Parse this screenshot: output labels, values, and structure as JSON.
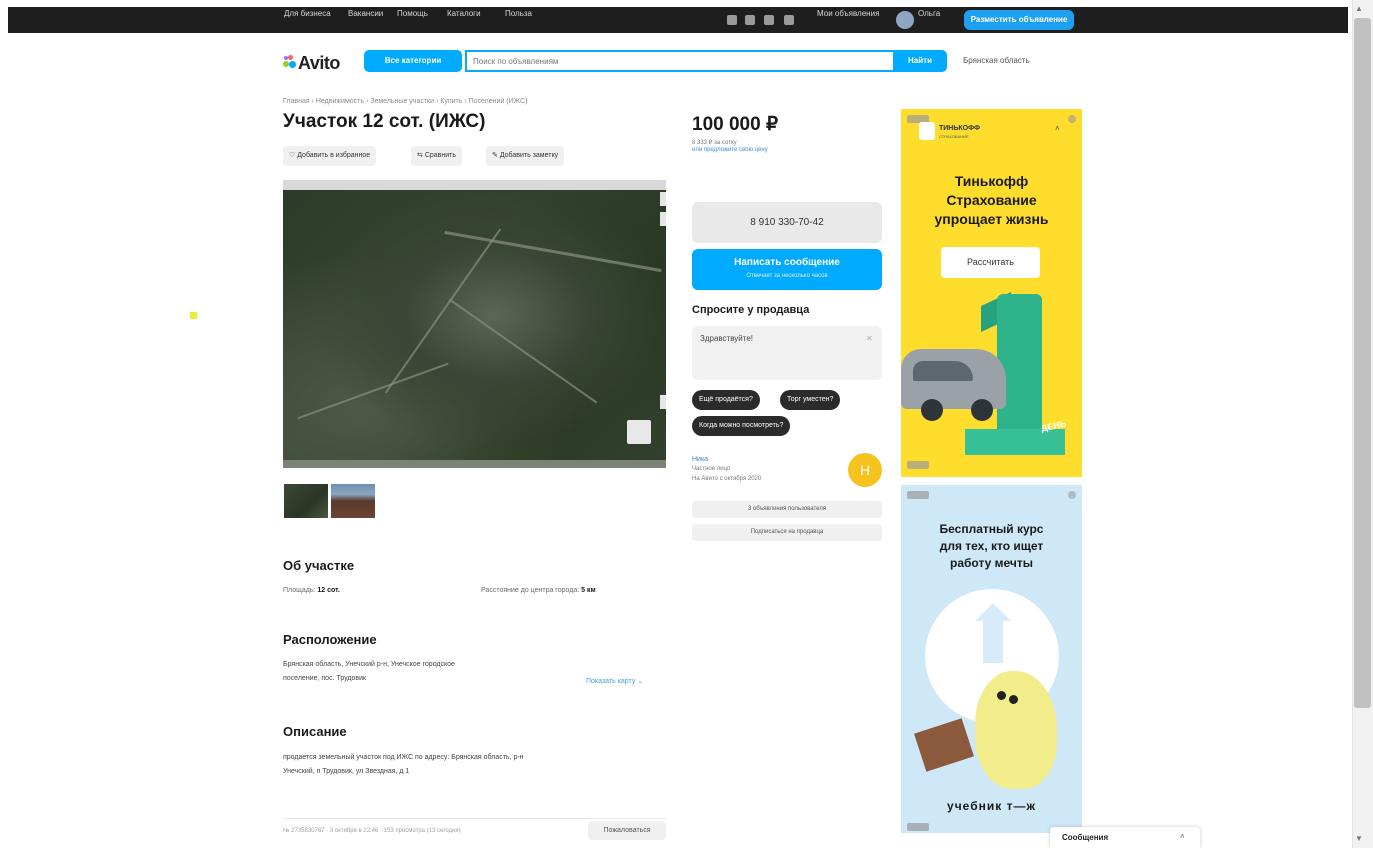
{
  "topbar": {
    "links": [
      "Для бизнеса",
      "Вакансии",
      "Помощь",
      "Каталоги",
      "Польза"
    ],
    "my_ads": "Мои объявления",
    "user": "Ольга",
    "post_ad": "Разместить объявление"
  },
  "header": {
    "logo": "Avito",
    "categories_btn": "Все категории",
    "search_placeholder": "Поиск по объявлениям",
    "search_btn": "Найти",
    "region": "Брянская область"
  },
  "listing": {
    "breadcrumb": "Главная › Недвижимость › Земельные участки › Купить › Поселений (ИЖС)",
    "title": "Участок 12 сот. (ИЖС)",
    "actions": [
      "Добавить в избранное",
      "Сравнить",
      "Добавить заметку"
    ],
    "price": "100 000 ₽",
    "price_per": "8 333 ₽ за сотку",
    "price_offer": "или предложите свою цену",
    "phone": "8 910 330-70-42",
    "write_btn": "Написать сообщение",
    "write_sub": "Отвечает за несколько часов",
    "ask_title": "Спросите у продавца",
    "ask_text": "Здравствуйте!",
    "chips": [
      "Ещё продаётся?",
      "Торг уместен?",
      "Когда можно посмотреть?"
    ],
    "seller": {
      "name": "Ника",
      "type": "Частное лицо",
      "since": "На Авито с октября 2020",
      "initial": "Н"
    },
    "seller_btns": [
      "3 объявления пользователя",
      "Подписаться на продавца"
    ]
  },
  "about": {
    "title": "Об участке",
    "area_label": "Площадь:",
    "area_value": "12 сот.",
    "distance_label": "Расстояние до центра города:",
    "distance_value": "5 км"
  },
  "location": {
    "title": "Расположение",
    "address1": "Брянская область, Унечский р-н, Унечское городское",
    "address2": "поселение, пос. Трудовик",
    "show_map": "Показать карту"
  },
  "description": {
    "title": "Описание",
    "line1": "продается земельный участок под ИЖС по адресу: Брянская область, р-н",
    "line2": "Унечский, п Трудовик, ул Звездная, д 1"
  },
  "footer": {
    "meta": "№ 2735830787 · 3 октября в 22:46 · 153 просмотра (13 сегодня)",
    "complain": "Пожаловаться"
  },
  "ads": {
    "label": "Реклама",
    "ad1": {
      "brand": "ТИНЬКОФФ",
      "brand_sub": "СТРАХОВАНИЕ",
      "line1": "Тинькофф",
      "line2": "Страхование",
      "line3": "упрощает жизнь",
      "cta": "Рассчитать",
      "badge": "ДЕНЬ"
    },
    "ad2": {
      "line1": "Бесплатный курс",
      "line2": "для тех, кто ищет",
      "line3": "работу мечты",
      "brand": "учебник т—ж"
    }
  },
  "messages_bar": {
    "label": "Сообщения"
  },
  "colors": {
    "accent": "#00aaff",
    "topbar": "#1e1e1e",
    "ad1_bg": "#ffdd2d",
    "ad2_bg": "#cfe8f8"
  }
}
